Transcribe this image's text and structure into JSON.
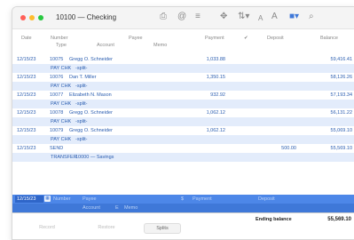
{
  "window": {
    "title": "10100 — Checking"
  },
  "toolbar": {
    "icons": [
      "print-icon",
      "at-icon",
      "report-icon",
      "move-icon",
      "sort-icon",
      "font-smaller-icon",
      "font-larger-icon",
      "columns-icon",
      "search-icon"
    ],
    "glyphs": {
      "print": "⎙",
      "at": "@",
      "report": "≡",
      "move": "✥",
      "sort": "⇅▾",
      "font_small": "A",
      "font_large": "A",
      "columns": "■▾",
      "search": "⌕"
    }
  },
  "header": {
    "date": "Date",
    "number": "Number",
    "payee": "Payee",
    "payment": "Payment",
    "cleared": "✔",
    "deposit": "Deposit",
    "balance": "Balance",
    "type": "Type",
    "account": "Account",
    "memo": "Memo"
  },
  "rows": [
    {
      "kind": "txn",
      "date": "12/15/23",
      "number": "10075",
      "payee": "Gregg O. Schneider",
      "payment": "1,033.88",
      "deposit": "",
      "balance": "59,416.41"
    },
    {
      "kind": "sub",
      "type": "PAY CHK",
      "account": "-split-"
    },
    {
      "kind": "txn",
      "date": "12/15/23",
      "number": "10076",
      "payee": "Dan T. Miller",
      "payment": "1,350.15",
      "deposit": "",
      "balance": "58,126.26"
    },
    {
      "kind": "sub",
      "type": "PAY CHK",
      "account": "-split-"
    },
    {
      "kind": "txn",
      "date": "12/15/23",
      "number": "10077",
      "payee": "Elizabeth N. Mason",
      "payment": "932.92",
      "deposit": "",
      "balance": "57,193.34"
    },
    {
      "kind": "sub",
      "type": "PAY CHK",
      "account": "-split-"
    },
    {
      "kind": "txn",
      "date": "12/15/23",
      "number": "10078",
      "payee": "Gregg O. Schneider",
      "payment": "1,062.12",
      "deposit": "",
      "balance": "56,131.22"
    },
    {
      "kind": "sub",
      "type": "PAY CHK",
      "account": "-split-"
    },
    {
      "kind": "txn",
      "date": "12/15/23",
      "number": "10079",
      "payee": "Gregg O. Schneider",
      "payment": "1,062.12",
      "deposit": "",
      "balance": "55,069.10"
    },
    {
      "kind": "sub",
      "type": "PAY CHK",
      "account": "-split-"
    },
    {
      "kind": "txn",
      "date": "12/15/23",
      "number": "SEND",
      "payee": "",
      "payment": "",
      "deposit": "500.00",
      "balance": "55,569.10"
    },
    {
      "kind": "sub",
      "type": "TRANSFER",
      "account": "10000 — Savings"
    }
  ],
  "edit_row": {
    "date": "12/15/23",
    "number": "Number",
    "payee": "Payee",
    "payment": "Payment",
    "deposit": "Deposit",
    "account": "Account",
    "memo": "Memo",
    "calendar_glyph": "▦",
    "currency_glyph": "$",
    "memo_flag": "E"
  },
  "footer": {
    "ending_label": "Ending balance",
    "ending_value": "55,569.10",
    "buttons": {
      "record": "Record",
      "restore": "Restore",
      "splits": "Splits"
    }
  },
  "colors": {
    "accent": "#4d87e8",
    "link": "#2a5db0",
    "stripe": "#e3ecfb"
  }
}
